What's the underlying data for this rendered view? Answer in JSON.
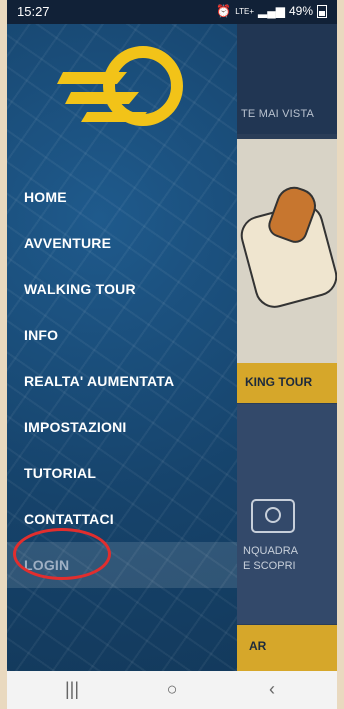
{
  "status_bar": {
    "time": "15:27",
    "signal_text": "LTE+",
    "battery": "49%"
  },
  "background_screen": {
    "top_text": "TE MAI VISTA",
    "tour_button": "KING TOUR",
    "camera_text_line1": "NQUADRA",
    "camera_text_line2": "E SCOPRI",
    "bottom_button": "AR"
  },
  "drawer": {
    "menu": [
      {
        "label": "HOME"
      },
      {
        "label": "AVVENTURE"
      },
      {
        "label": "WALKING TOUR"
      },
      {
        "label": "INFO"
      },
      {
        "label": "REALTA' AUMENTATA"
      },
      {
        "label": "IMPOSTAZIONI"
      },
      {
        "label": "TUTORIAL"
      },
      {
        "label": "CONTATTACI"
      },
      {
        "label": "LOGIN"
      }
    ]
  },
  "colors": {
    "brand_yellow": "#f2c318",
    "drawer_blue": "#17456e",
    "highlight_red": "#e22e2e"
  },
  "nav_bar": {
    "recent_icon": "|||",
    "home_icon": "○",
    "back_icon": "‹"
  }
}
